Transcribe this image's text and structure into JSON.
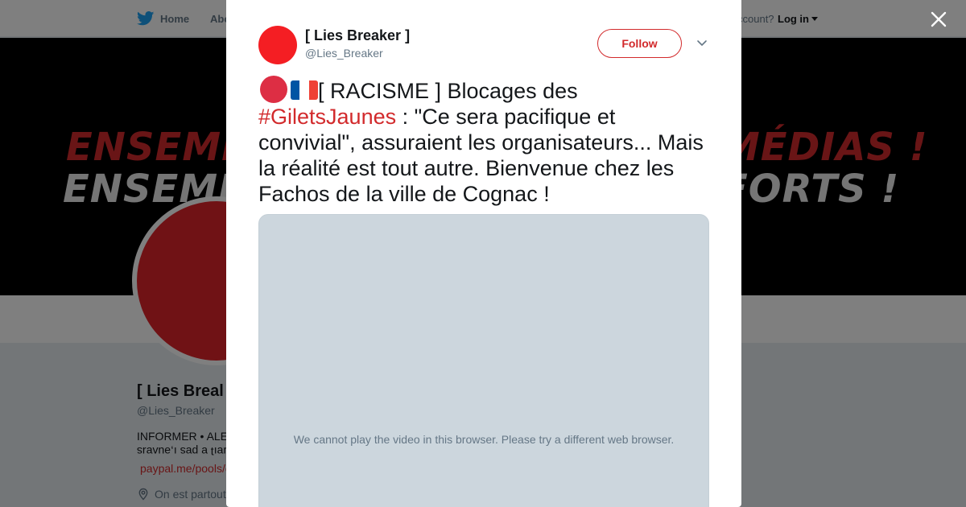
{
  "background": {
    "nav": {
      "home_label": "Home",
      "about_label": "Abo",
      "account_prompt": "ccount?",
      "login_label": "Log in"
    },
    "banner": {
      "line1_left": "ENSEMB",
      "line2_left": "ENSEMB",
      "line1_right": "MÉDIAS !",
      "line2_right": "FORTS !"
    },
    "profile": {
      "name": "[ Lies Breal",
      "handle": "@Lies_Breaker",
      "bio_line1": "INFORMER • ALE",
      "bio_line2": "ɹɐıʇ ɐ pɐs ı,ǝuʌɐɹs",
      "link": "paypal.me/pools/c",
      "location": "On est partout"
    }
  },
  "modal": {
    "author_name": "[ Lies Breaker ]",
    "author_handle": "@Lies_Breaker",
    "follow_label": "Follow",
    "tweet": {
      "part1": "[ RACISME ] Blocages des ",
      "hashtag": "#GiletsJaunes",
      "part2": " : \"Ce sera pacifique et convivial\", assuraient les organisateurs... Mais la réalité est tout autre. Bienvenue chez les Fachos de la ville de Cognac !"
    },
    "media_message": "We cannot play the video in this browser. Please try a different web browser."
  },
  "icons": {
    "nav_home": "twitter-bird-icon",
    "location": "location-pin-icon",
    "close": "close-icon",
    "menu": "chevron-down-icon",
    "emoji1": "red-circle-emoji",
    "emoji2": "france-flag-emoji"
  },
  "colors": {
    "accent": "#d22a2c",
    "twitter_blue": "#1da1f2",
    "avatar_red": "#f41e23",
    "media_bg": "#ccd6dd"
  }
}
